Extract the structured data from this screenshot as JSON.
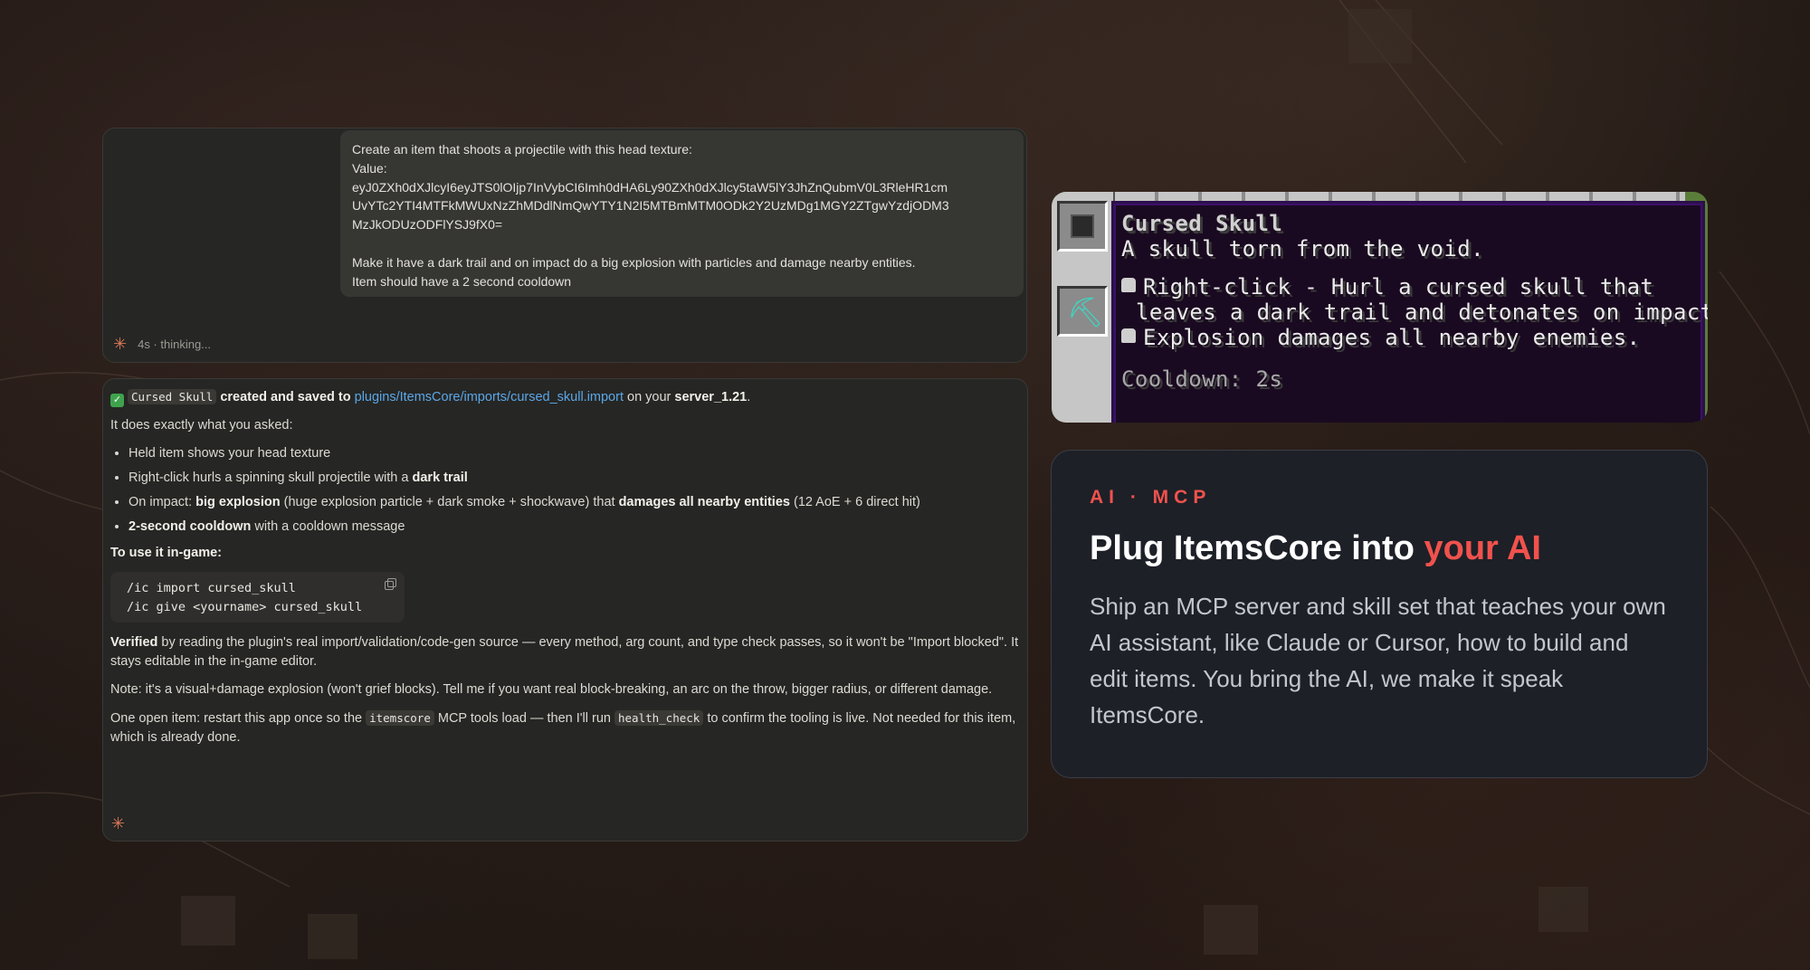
{
  "prompt": {
    "lines": [
      "Create an item that shoots a projectile with this head texture:",
      "Value:",
      "eyJ0ZXh0dXJlcyI6eyJTS0lOIjp7InVybCI6Imh0dHA6Ly90ZXh0dXJlcy5taW5lY3JhZnQubmV0L3RleHR1cm",
      "UvYTc2YTI4MTFkMWUxNzZhMDdlNmQwYTY1N2I5MTBmMTM0ODk2Y2UzMDg1MGY2ZTgwYzdjODM3",
      "MzJkODUzODFlYSJ9fX0="
    ],
    "lines2": [
      "Make it have a dark trail and on impact do a big explosion with particles and damage nearby entities.",
      "Item should have a 2 second cooldown"
    ],
    "spark_icon": "sparkle-icon",
    "thinking": "4s · thinking..."
  },
  "response": {
    "summary": {
      "item_code": "Cursed Skull",
      "created_text": " created and saved to ",
      "path": "plugins/ItemsCore/imports/cursed_skull.import",
      "on_text": " on your ",
      "server": "server_1.21",
      "end": "."
    },
    "intro": "It does exactly what you asked:",
    "bullets": {
      "b1": "Held item shows your head texture",
      "b2_pre": "Right-click hurls a spinning skull projectile with a ",
      "b2_bold": "dark trail",
      "b3_pre": "On impact: ",
      "b3_bold1": "big explosion",
      "b3_mid": " (huge explosion particle + dark smoke + shockwave) that ",
      "b3_bold2": "damages all nearby entities",
      "b3_end": " (12 AoE + 6 direct hit)",
      "b4_bold": "2-second cooldown",
      "b4_end": " with a cooldown message"
    },
    "to_use": "To use it in-game:",
    "code_lines": [
      "/ic import cursed_skull",
      "/ic give <yourname> cursed_skull"
    ],
    "verified_bold": "Verified",
    "verified_text": " by reading the plugin's real import/validation/code-gen source — every method, arg count, and type check passes, so it won't be \"Import blocked\". It stays editable in the in-game editor.",
    "note": "Note: it's a visual+damage explosion (won't grief blocks). Tell me if you want real block-breaking, an arc on the throw, bigger radius, or different damage.",
    "open_pre": "One open item: restart this app once so the ",
    "open_code1": "itemscore",
    "open_mid": " MCP tools load — then I'll run ",
    "open_code2": "health_check",
    "open_end": " to confirm the tooling is live. Not needed for this item, which is already done."
  },
  "tooltip": {
    "name": "Cursed Skull",
    "lore1": "A skull torn from the void.",
    "line1": "Right-click - Hurl a cursed skull that",
    "line2": "leaves a dark trail and detonates on impact.",
    "line3": "Explosion damages all nearby enemies.",
    "cooldown": "Cooldown: 2s"
  },
  "ai_card": {
    "eyebrow": "AI · MCP",
    "headline_pre": "Plug ItemsCore into ",
    "headline_accent": "your AI",
    "body": "Ship an MCP server and skill set that teaches your own AI assistant, like Claude or Cursor, how to build and edit items. You bring the AI, we make it speak ItemsCore.",
    "accent_color": "#f0524d"
  }
}
